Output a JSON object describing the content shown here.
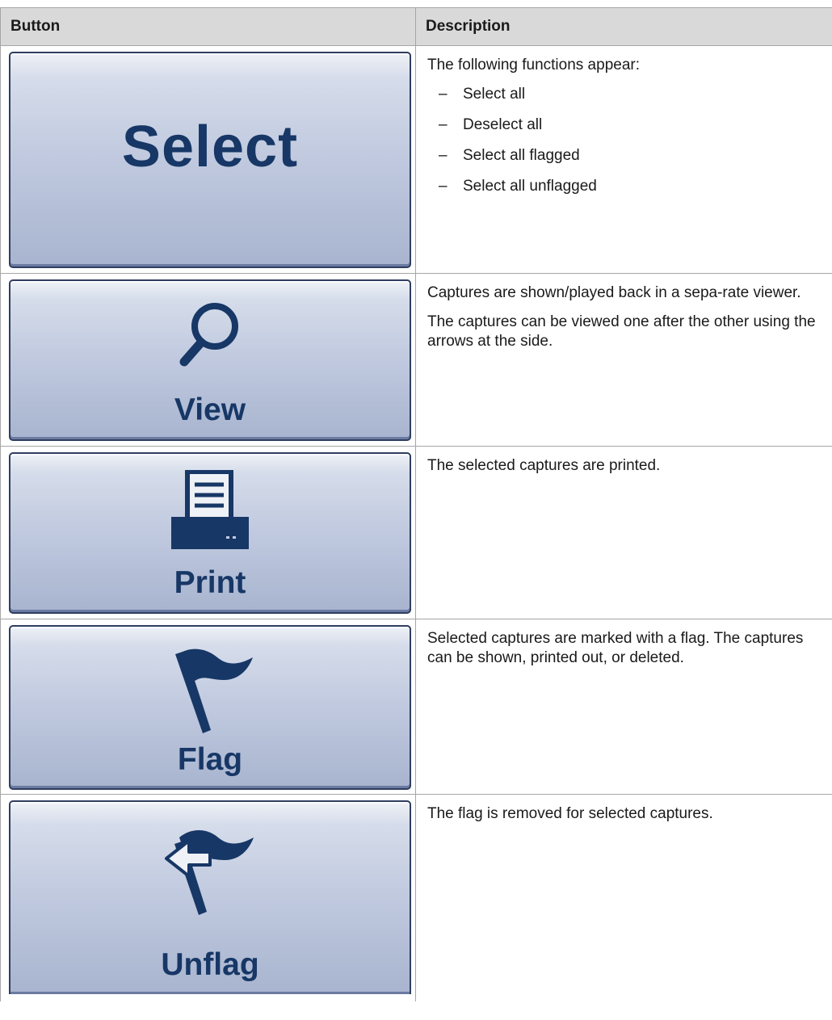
{
  "table": {
    "headers": {
      "button": "Button",
      "description": "Description"
    },
    "rows": [
      {
        "button_label": "Select",
        "icon": "none",
        "intro": "The following functions appear:",
        "items": [
          "Select all",
          "Deselect all",
          "Select all flagged",
          "Select all unflagged"
        ]
      },
      {
        "button_label": "View",
        "icon": "magnifier-icon",
        "para1": "Captures are shown/played back in a sepa-rate viewer.",
        "para2": "The captures can be viewed one after the other using the arrows at the side."
      },
      {
        "button_label": "Print",
        "icon": "printer-icon",
        "para1": "The selected captures are printed."
      },
      {
        "button_label": "Flag",
        "icon": "flag-icon",
        "para1": "Selected captures are marked with a flag. The captures can be shown, printed out, or deleted."
      },
      {
        "button_label": "Unflag",
        "icon": "unflag-icon",
        "para1": "The flag is removed for selected captures."
      }
    ]
  },
  "list_marker": "–",
  "colors": {
    "button_text": "#173766",
    "header_bg": "#d9d9d9",
    "button_border": "#2f3e60"
  }
}
